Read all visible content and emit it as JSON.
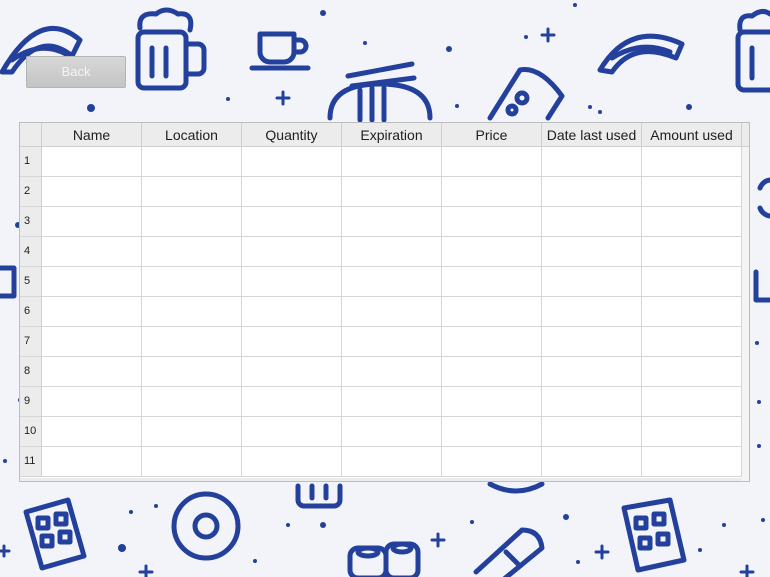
{
  "back_button": {
    "label": "Back"
  },
  "table": {
    "columns": [
      "Name",
      "Location",
      "Quantity",
      "Expiration",
      "Price",
      "Date last used",
      "Amount used"
    ],
    "row_numbers": [
      "1",
      "2",
      "3",
      "4",
      "5",
      "6",
      "7",
      "8",
      "9",
      "10",
      "11"
    ]
  },
  "background": {
    "pattern_icons": [
      "taco-icon",
      "beer-mug-icon",
      "coffee-cup-icon",
      "noodle-bowl-icon",
      "pizza-slice-icon",
      "chocolate-bar-icon",
      "donut-icon",
      "sushi-icon",
      "burrito-icon",
      "plus-sparkle-icon",
      "dot-icon"
    ],
    "pattern_color": "#22409c",
    "page_color": "#f3f4f9"
  }
}
